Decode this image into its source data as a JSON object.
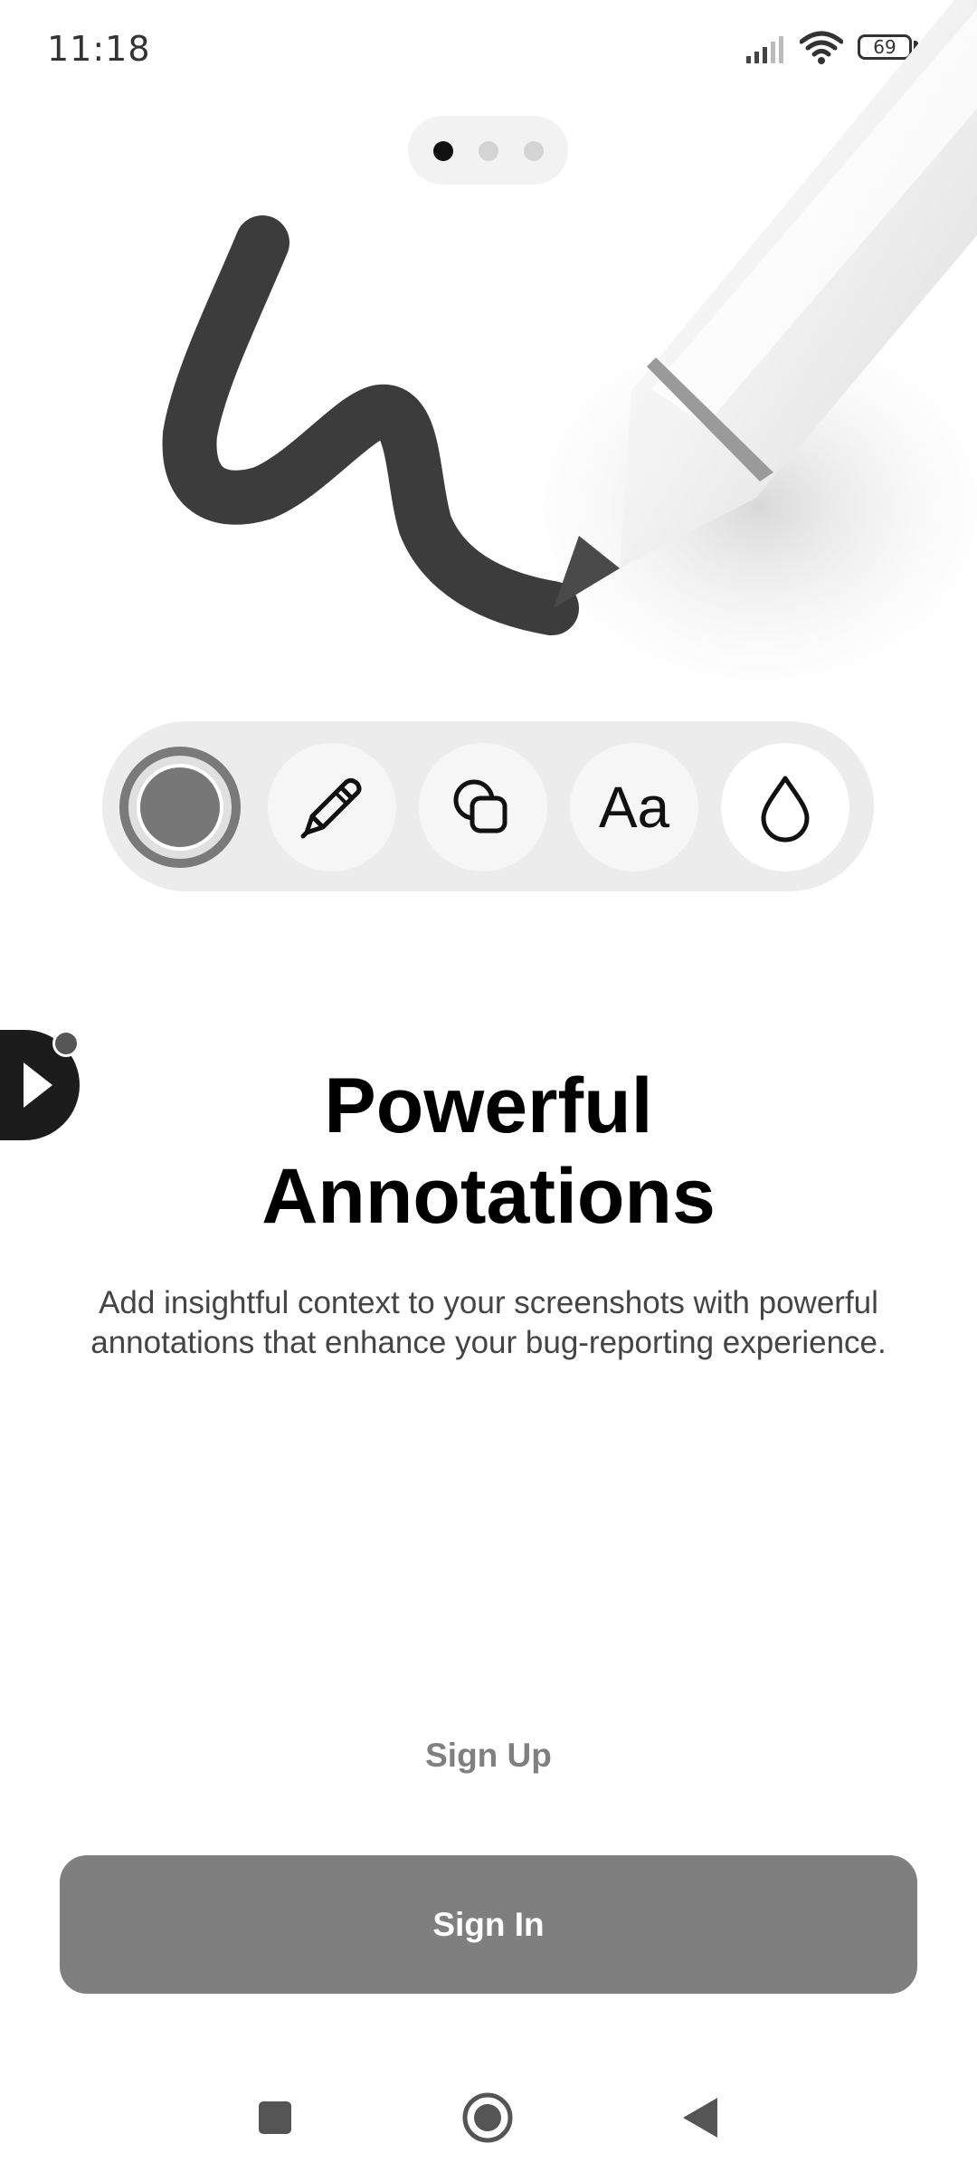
{
  "status_bar": {
    "time": "11:18",
    "battery_level": "69",
    "icons": [
      "signal-icon",
      "wifi-icon",
      "battery-icon"
    ]
  },
  "pager": {
    "page_count": 3,
    "active_index": 0
  },
  "toolbar": {
    "tools": [
      {
        "name": "color-picker",
        "icon": "color-circle-icon"
      },
      {
        "name": "pen",
        "icon": "pen-icon"
      },
      {
        "name": "shapes",
        "icon": "shapes-icon"
      },
      {
        "name": "text",
        "icon": "text-icon",
        "label": "Aa"
      },
      {
        "name": "blur",
        "icon": "droplet-icon"
      }
    ]
  },
  "content": {
    "title_line1": "Powerful",
    "title_line2": "Annotations",
    "description_line1": "Add insightful context to your screenshots with powerful",
    "description_line2": "annotations that enhance your bug-reporting experience."
  },
  "actions": {
    "sign_up_label": "Sign Up",
    "sign_in_label": "Sign In"
  },
  "colors": {
    "primary_button": "#7f7f7f",
    "title": "#000000",
    "body_text": "#444444",
    "stroke": "#3c3c3c"
  },
  "navigation": {
    "buttons": [
      "recents-icon",
      "home-icon",
      "back-icon"
    ]
  }
}
